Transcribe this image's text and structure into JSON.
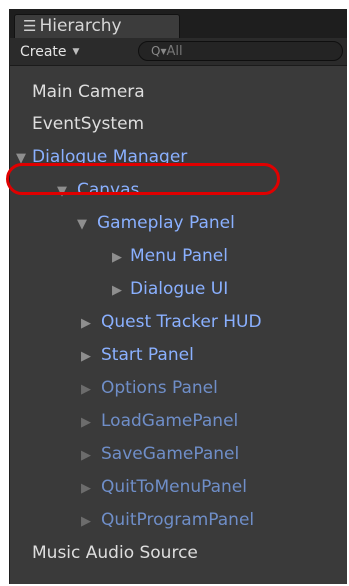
{
  "tab": {
    "title": "Hierarchy",
    "icon": "hierarchy-list-icon"
  },
  "toolbar": {
    "create_label": "Create",
    "search_placeholder": "All"
  },
  "tree": [
    {
      "label": "Main Camera",
      "color": "white",
      "arrow": ""
    },
    {
      "label": "EventSystem",
      "color": "white",
      "arrow": ""
    },
    {
      "label": "Dialogue Manager",
      "color": "blue",
      "arrow": "▼"
    },
    {
      "label": "Canvas",
      "color": "blue",
      "arrow": "▼"
    },
    {
      "label": "Gameplay Panel",
      "color": "blue",
      "arrow": "▼"
    },
    {
      "label": "Menu Panel",
      "color": "blue",
      "arrow": "▶"
    },
    {
      "label": "Dialogue UI",
      "color": "blue",
      "arrow": "▶"
    },
    {
      "label": "Quest Tracker HUD",
      "color": "blue",
      "arrow": "▶"
    },
    {
      "label": "Start Panel",
      "color": "blue",
      "arrow": "▶"
    },
    {
      "label": "Options Panel",
      "color": "dim",
      "arrow": "▶"
    },
    {
      "label": "LoadGamePanel",
      "color": "dim",
      "arrow": "▶"
    },
    {
      "label": "SaveGamePanel",
      "color": "dim",
      "arrow": "▶"
    },
    {
      "label": "QuitToMenuPanel",
      "color": "dim",
      "arrow": "▶"
    },
    {
      "label": "QuitProgramPanel",
      "color": "dim",
      "arrow": "▶"
    },
    {
      "label": "Music Audio Source",
      "color": "white",
      "arrow": ""
    }
  ],
  "colors": {
    "panel_bg": "#3a3a3a",
    "active_blue": "#8ab0ff",
    "inactive_blue": "#6f8ec8",
    "highlight_red": "#e00000"
  }
}
